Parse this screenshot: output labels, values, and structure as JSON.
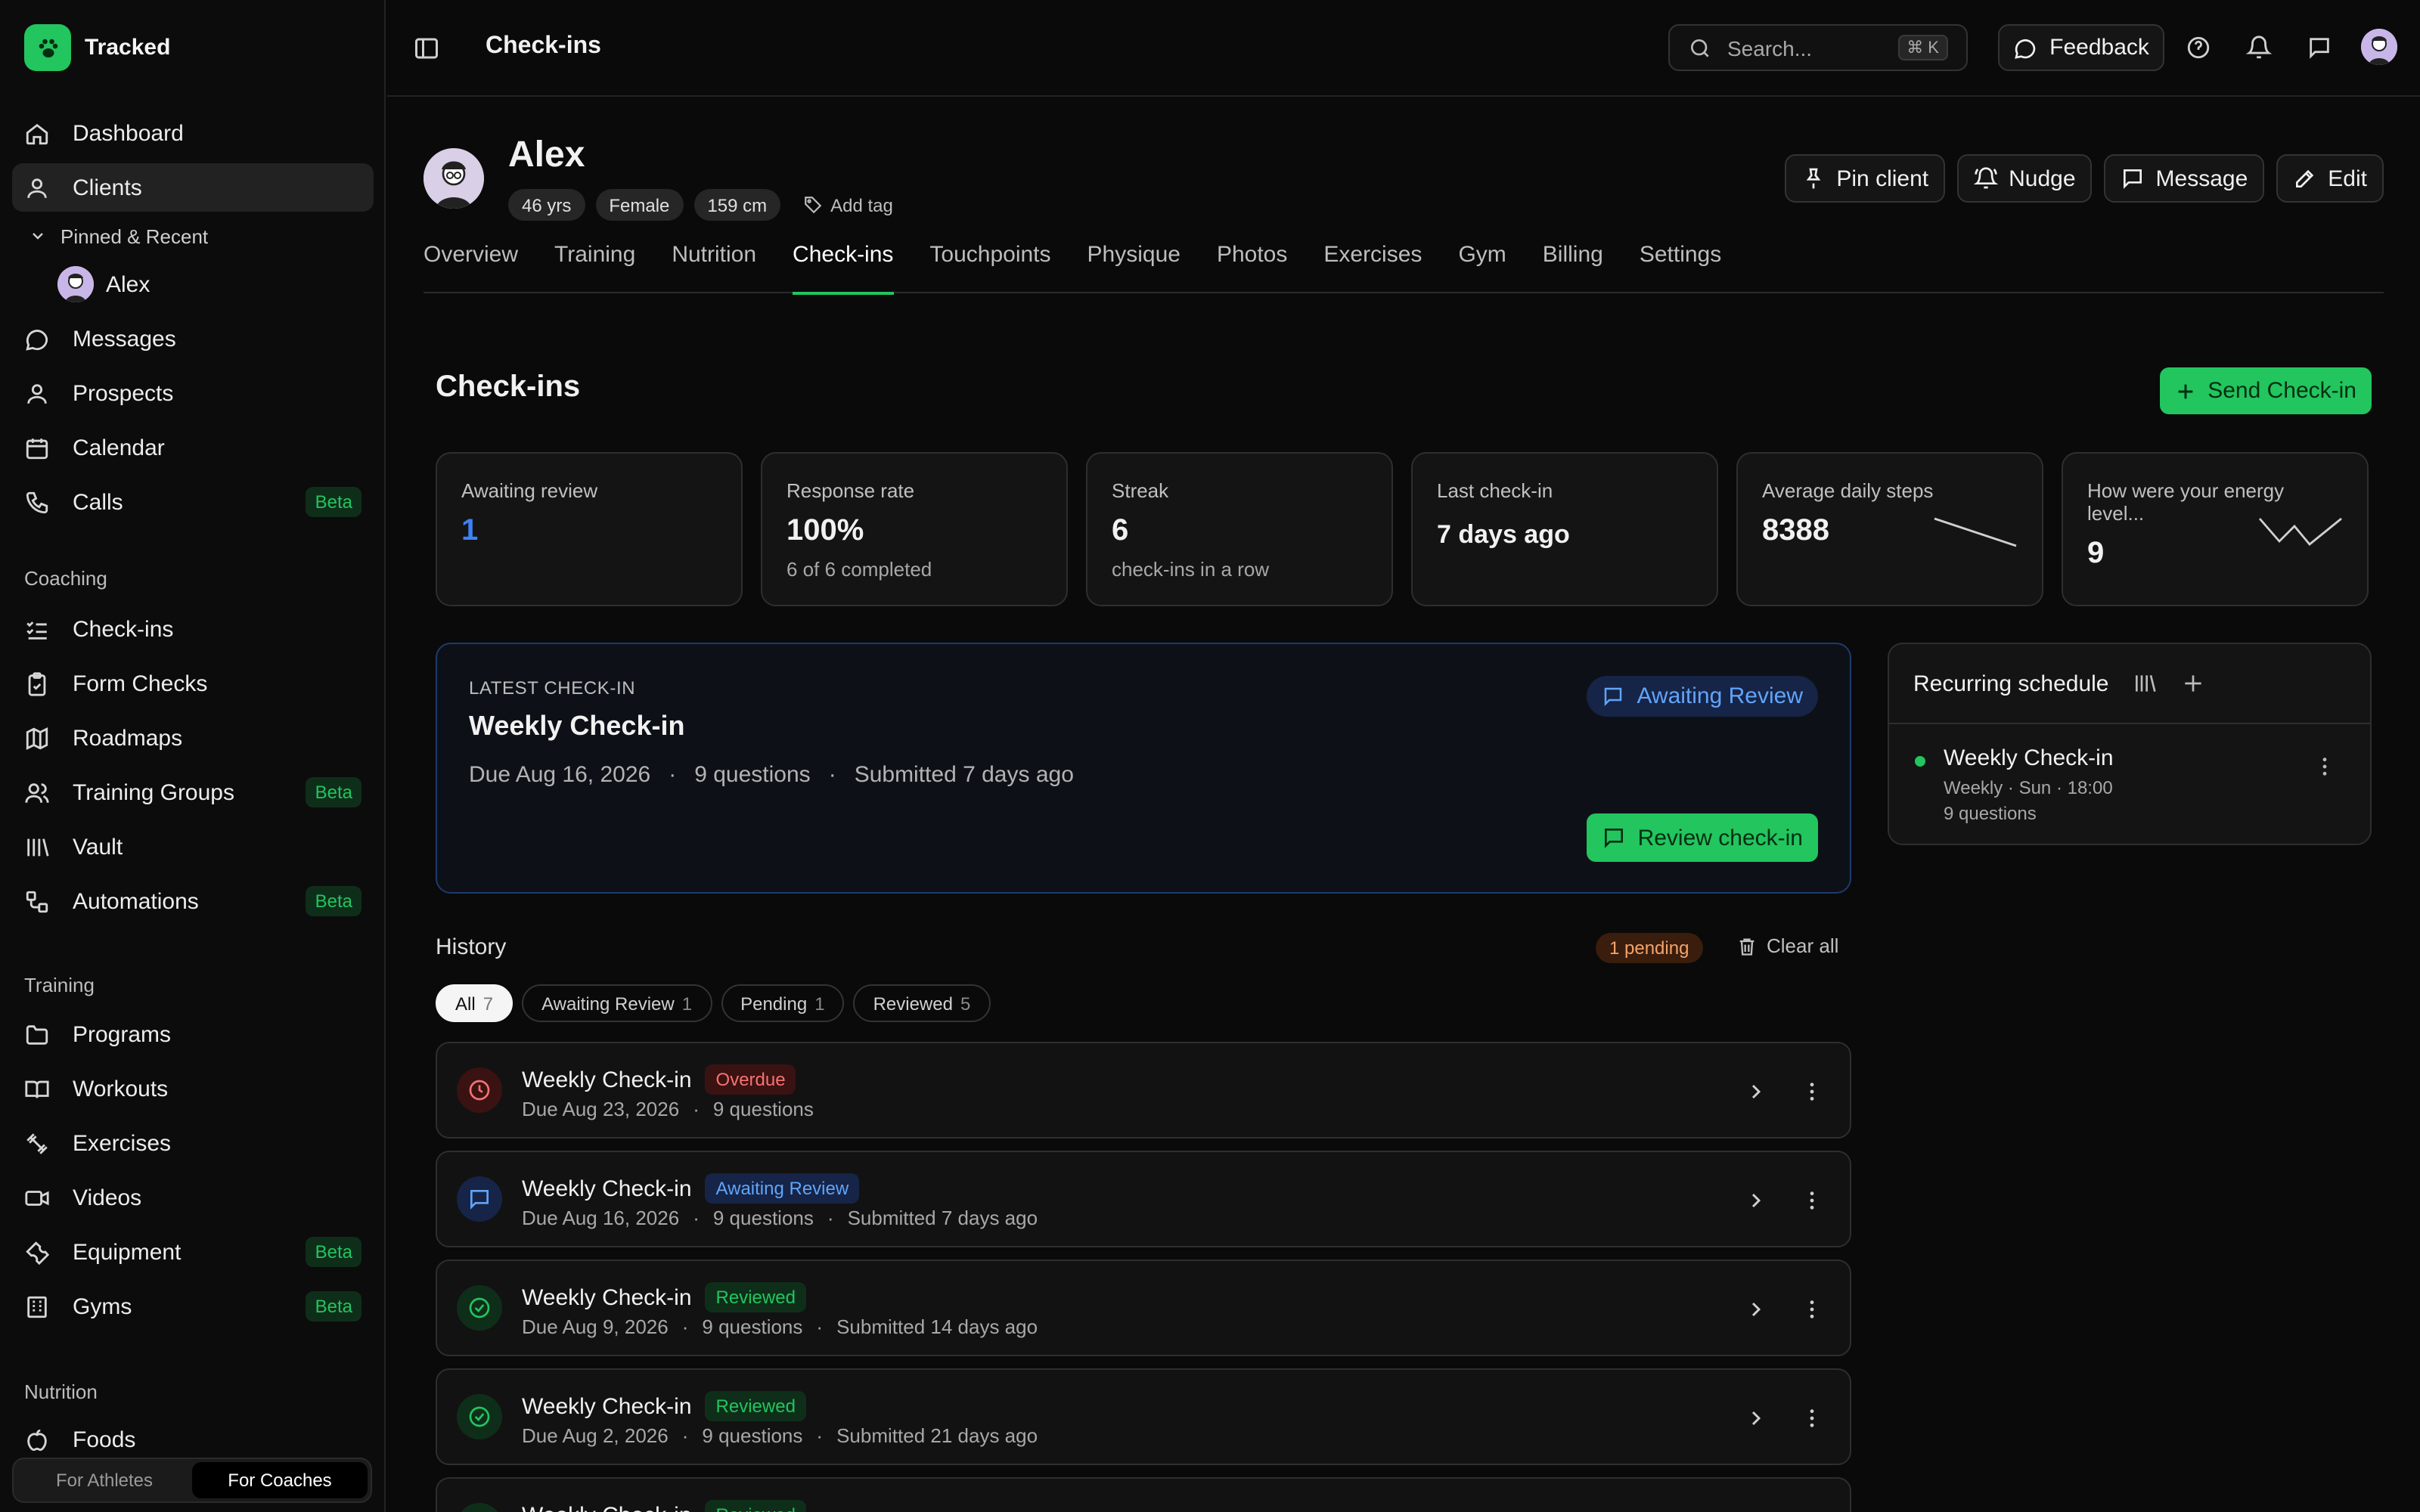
{
  "app": {
    "name": "Tracked"
  },
  "sidebar": {
    "top_items": [
      {
        "label": "Dashboard"
      },
      {
        "label": "Clients"
      }
    ],
    "pinned_header": "Pinned & Recent",
    "pinned_items": [
      {
        "label": "Alex"
      }
    ],
    "after_pinned": [
      {
        "label": "Messages"
      },
      {
        "label": "Prospects"
      },
      {
        "label": "Calendar"
      },
      {
        "label": "Calls",
        "badge": "Beta"
      }
    ],
    "coaching_label": "Coaching",
    "coaching": [
      {
        "label": "Check-ins"
      },
      {
        "label": "Form Checks"
      },
      {
        "label": "Roadmaps"
      },
      {
        "label": "Training Groups",
        "badge": "Beta"
      },
      {
        "label": "Vault"
      },
      {
        "label": "Automations",
        "badge": "Beta"
      }
    ],
    "training_label": "Training",
    "training": [
      {
        "label": "Programs"
      },
      {
        "label": "Workouts"
      },
      {
        "label": "Exercises"
      },
      {
        "label": "Videos"
      },
      {
        "label": "Equipment",
        "badge": "Beta"
      },
      {
        "label": "Gyms",
        "badge": "Beta"
      }
    ],
    "nutrition_label": "Nutrition",
    "nutrition": [
      {
        "label": "Foods"
      }
    ],
    "audience_toggle": {
      "options": [
        "For Athletes",
        "For Coaches"
      ],
      "selected": "For Coaches"
    }
  },
  "topbar": {
    "title": "Check-ins",
    "search_placeholder": "Search...",
    "search_shortcut": "⌘ K",
    "feedback_label": "Feedback"
  },
  "client": {
    "name": "Alex",
    "age": "46 yrs",
    "gender": "Female",
    "height": "159 cm",
    "add_tag": "Add tag",
    "actions": {
      "pin": "Pin client",
      "nudge": "Nudge",
      "message": "Message",
      "edit": "Edit"
    },
    "tabs": [
      "Overview",
      "Training",
      "Nutrition",
      "Check-ins",
      "Touchpoints",
      "Physique",
      "Photos",
      "Exercises",
      "Gym",
      "Billing",
      "Settings"
    ],
    "active_tab": "Check-ins"
  },
  "main": {
    "title": "Check-ins",
    "send_button": "Send Check-in",
    "stats": [
      {
        "label": "Awaiting review",
        "value": "1"
      },
      {
        "label": "Response rate",
        "value": "100%",
        "sub": "6 of 6 completed"
      },
      {
        "label": "Streak",
        "value": "6",
        "sub": "check-ins in a row"
      },
      {
        "label": "Last check-in",
        "value": "7 days ago"
      },
      {
        "label": "Average daily steps",
        "value": "8388"
      },
      {
        "label": "How were your energy level...",
        "value": "9"
      }
    ],
    "latest": {
      "kicker": "LATEST CHECK-IN",
      "title": "Weekly Check-in",
      "due": "Due Aug 16, 2026",
      "questions": "9 questions",
      "submitted": "Submitted 7 days ago",
      "status": "Awaiting Review",
      "review_button": "Review check-in"
    },
    "schedule": {
      "title": "Recurring schedule",
      "item": {
        "name": "Weekly Check-in",
        "cadence": "Weekly · Sun · 18:00",
        "questions": "9 questions"
      }
    },
    "history": {
      "title": "History",
      "pending_badge": "1 pending",
      "clear_all": "Clear all",
      "filters": [
        {
          "label": "All",
          "count": "7"
        },
        {
          "label": "Awaiting Review",
          "count": "1"
        },
        {
          "label": "Pending",
          "count": "1"
        },
        {
          "label": "Reviewed",
          "count": "5"
        }
      ],
      "items": [
        {
          "name": "Weekly Check-in",
          "status": "Overdue",
          "due": "Due Aug 23, 2026",
          "questions": "9 questions",
          "submitted": ""
        },
        {
          "name": "Weekly Check-in",
          "status": "Awaiting Review",
          "due": "Due Aug 16, 2026",
          "questions": "9 questions",
          "submitted": "Submitted 7 days ago"
        },
        {
          "name": "Weekly Check-in",
          "status": "Reviewed",
          "due": "Due Aug 9, 2026",
          "questions": "9 questions",
          "submitted": "Submitted 14 days ago"
        },
        {
          "name": "Weekly Check-in",
          "status": "Reviewed",
          "due": "Due Aug 2, 2026",
          "questions": "9 questions",
          "submitted": "Submitted 21 days ago"
        },
        {
          "name": "Weekly Check-in",
          "status": "Reviewed"
        }
      ]
    }
  },
  "colors": {
    "accent": "#22c55e",
    "blue": "#3b82f6",
    "danger": "#f87171",
    "background": "#0a0a0a"
  }
}
